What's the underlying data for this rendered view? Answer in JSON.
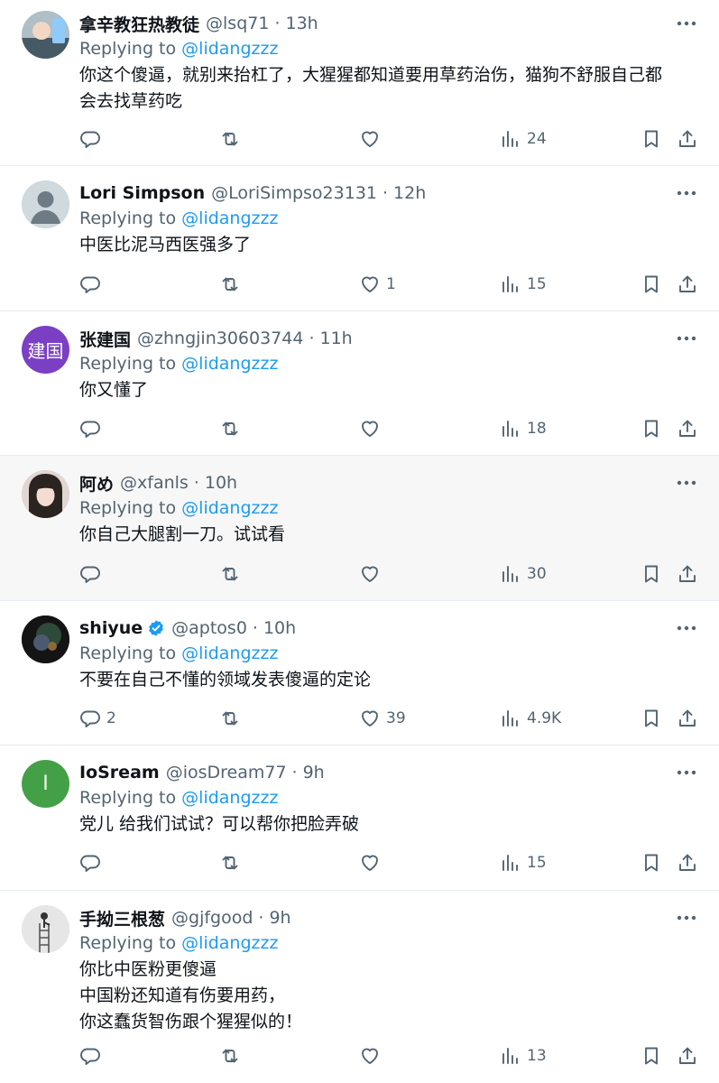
{
  "replying_label": "Replying to",
  "tweets": [
    {
      "name": "拿辛教狂热教徒",
      "handle": "@lsq71",
      "time": "13h",
      "reply_to": "@lidangzzz",
      "lines": [
        "你这个傻逼，就别来抬杠了，大猩猩都知道要用草药治伤，猫狗不舒服自己都",
        "会去找草药吃"
      ],
      "replies": "",
      "retweets": "",
      "likes": "",
      "views": "24",
      "avatar": "photo"
    },
    {
      "name": "Lori Simpson",
      "handle": "@LoriSimpso23131",
      "time": "12h",
      "reply_to": "@lidangzzz",
      "lines": [
        "中医比泥马西医强多了"
      ],
      "replies": "",
      "retweets": "",
      "likes": "1",
      "views": "15",
      "avatar": "default-profile"
    },
    {
      "name": "张建国",
      "handle": "@zhngjin30603744",
      "time": "11h",
      "reply_to": "@lidangzzz",
      "lines": [
        "你又懂了"
      ],
      "replies": "",
      "retweets": "",
      "likes": "",
      "views": "18",
      "avatar": "initials",
      "avatar_text": "建国",
      "avatar_color": "#7b3fc4"
    },
    {
      "name": "阿め",
      "handle": "@xfanls",
      "time": "10h",
      "reply_to": "@lidangzzz",
      "lines": [
        "你自己大腿割一刀。试试看"
      ],
      "replies": "",
      "retweets": "",
      "likes": "",
      "views": "30",
      "avatar": "photo"
    },
    {
      "name": "shiyue",
      "handle": "@aptos0",
      "time": "10h",
      "reply_to": "@lidangzzz",
      "lines": [
        "不要在自己不懂的领域发表傻逼的定论"
      ],
      "replies": "2",
      "retweets": "",
      "likes": "39",
      "views": "4.9K",
      "verified": true,
      "verified_color": "#1d9bf0",
      "avatar": "photo"
    },
    {
      "name": "IoSream",
      "handle": "@iosDream77",
      "time": "9h",
      "reply_to": "@lidangzzz",
      "lines": [
        "党儿 给我们试试？可以帮你把脸弄破"
      ],
      "replies": "",
      "retweets": "",
      "likes": "",
      "views": "15",
      "avatar": "initials",
      "avatar_text": "I",
      "avatar_color": "#43a047"
    },
    {
      "name": "手拗三根葱",
      "handle": "@gjfgood",
      "time": "9h",
      "reply_to": "@lidangzzz",
      "lines": [
        "你比中医粉更傻逼",
        "中国粉还知道有伤要用药，",
        "你这蠢货智伤跟个猩猩似的！"
      ],
      "replies": "",
      "retweets": "",
      "likes": "",
      "views": "13",
      "avatar": "photo"
    }
  ],
  "icons": {
    "reply": "reply-icon",
    "retweet": "retweet-icon",
    "like": "heart-icon",
    "views": "views-icon",
    "bookmark": "bookmark-icon",
    "share": "share-icon",
    "more": "more-icon",
    "verified": "verified-badge-icon"
  },
  "colors": {
    "link": "#1d9bf0",
    "muted": "#536471",
    "text": "#0f1419",
    "highlight_bg": "#f7f7f7",
    "divider": "#e6ecf0"
  }
}
